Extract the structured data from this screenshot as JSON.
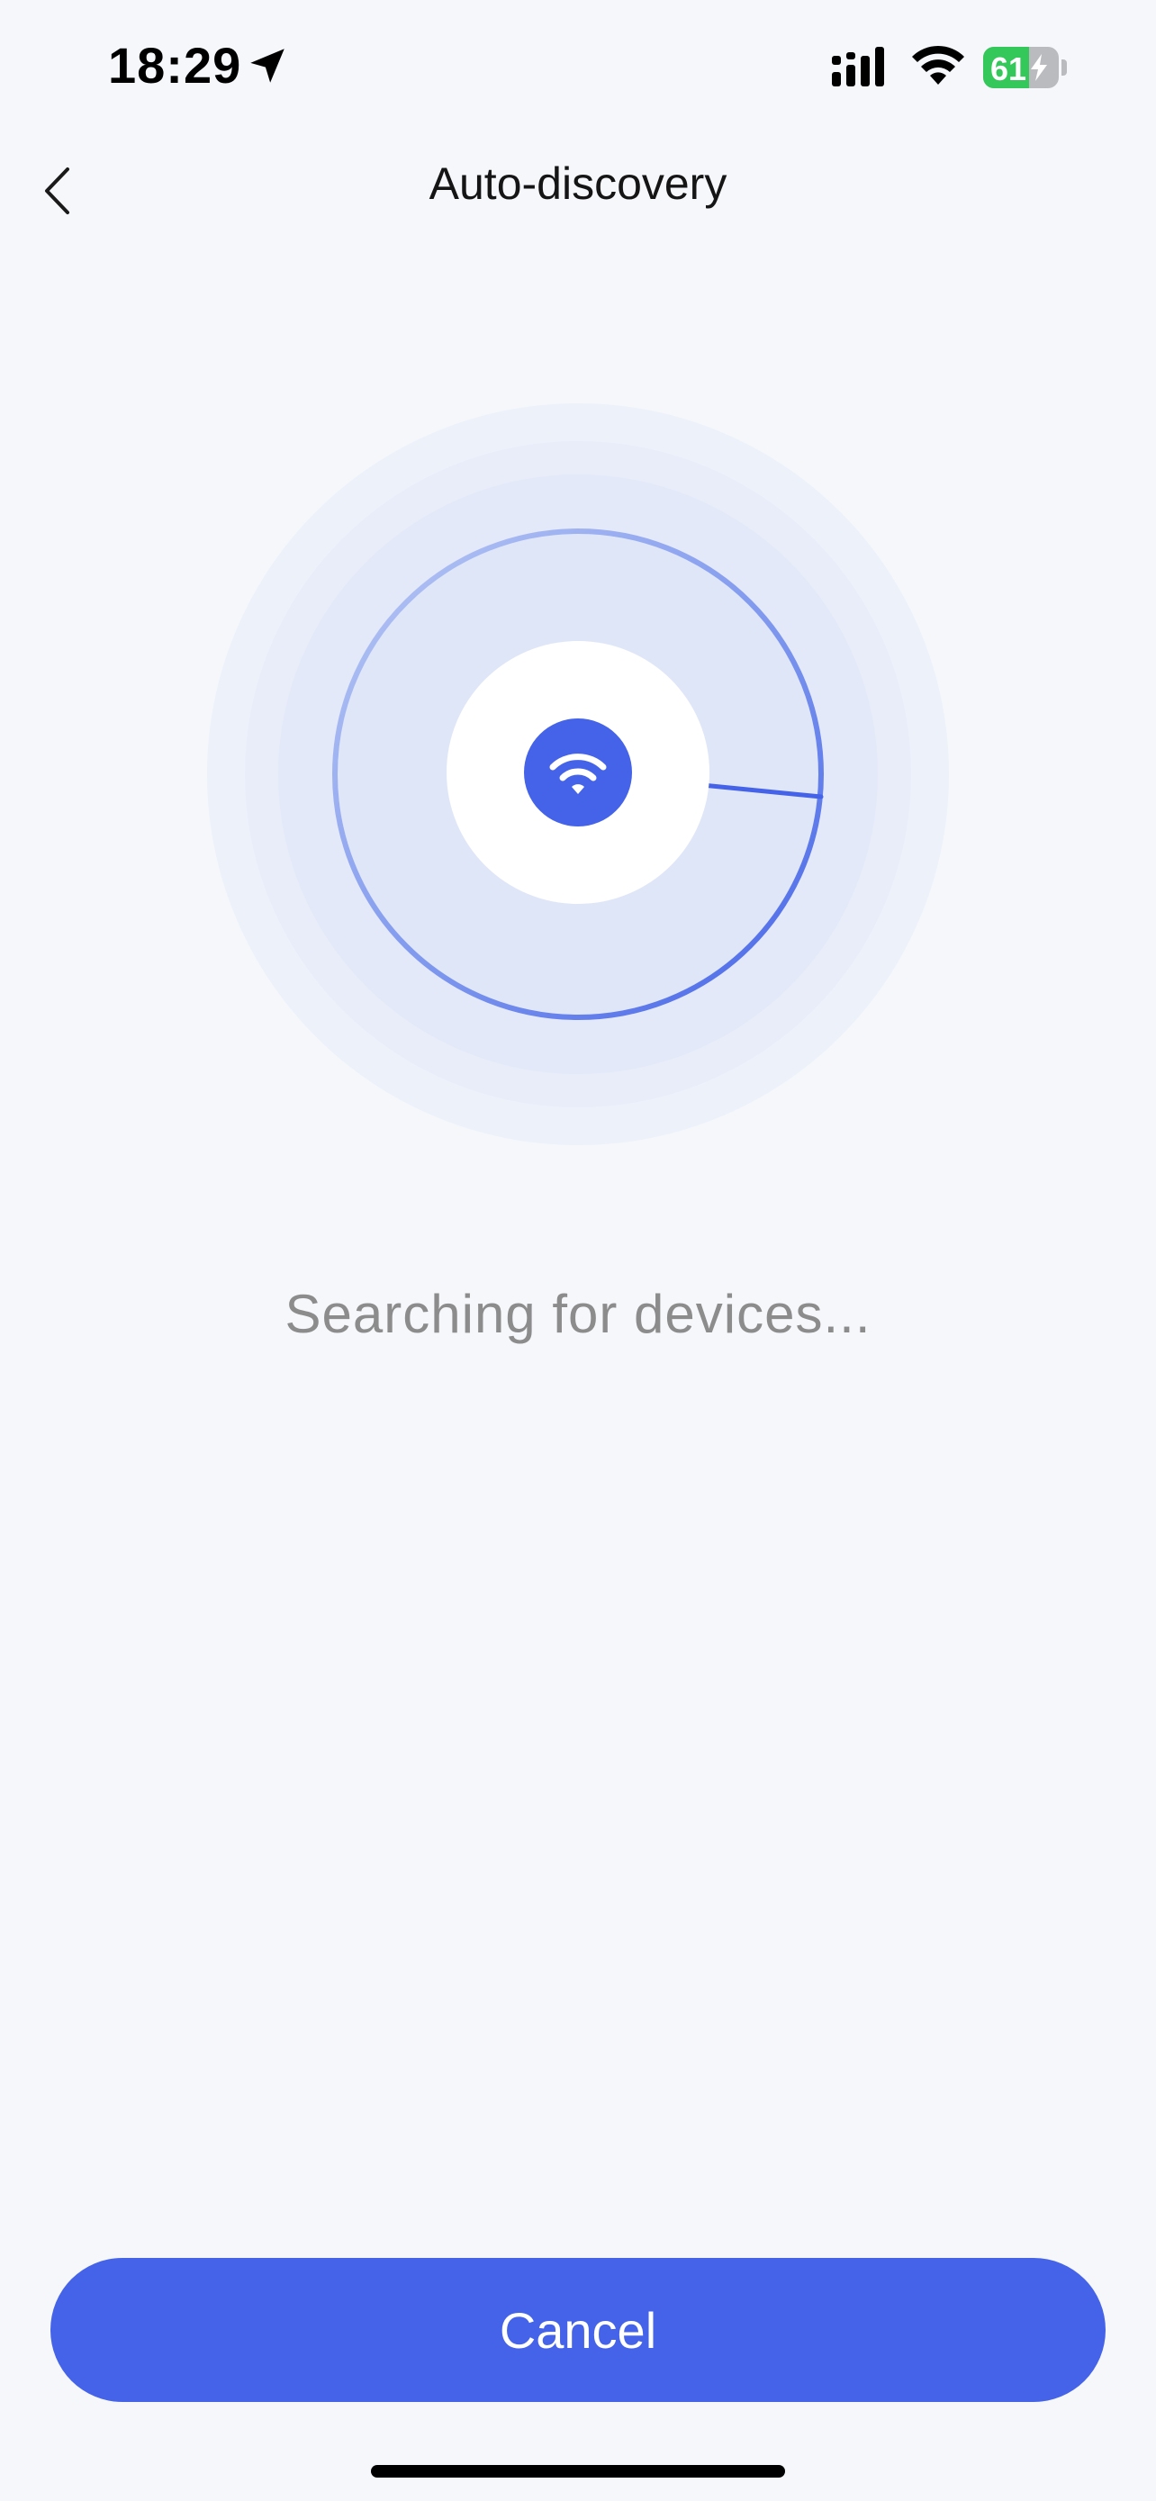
{
  "status_bar": {
    "time": "18:29",
    "battery_level": "61",
    "battery_fraction": 0.61,
    "icons": [
      "location-arrow-icon",
      "cellular-signal-icon",
      "wifi-icon",
      "battery-charging-icon"
    ]
  },
  "nav": {
    "title": "Auto-discovery",
    "back_icon": "chevron-left-icon"
  },
  "scan": {
    "center_icon": "wifi-icon",
    "status_text": "Searching for devices..."
  },
  "actions": {
    "cancel_label": "Cancel"
  },
  "colors": {
    "background": "#f5f7fb",
    "accent": "#4463e8",
    "status_text": "#8c8c8c",
    "battery_green": "#34c759"
  }
}
